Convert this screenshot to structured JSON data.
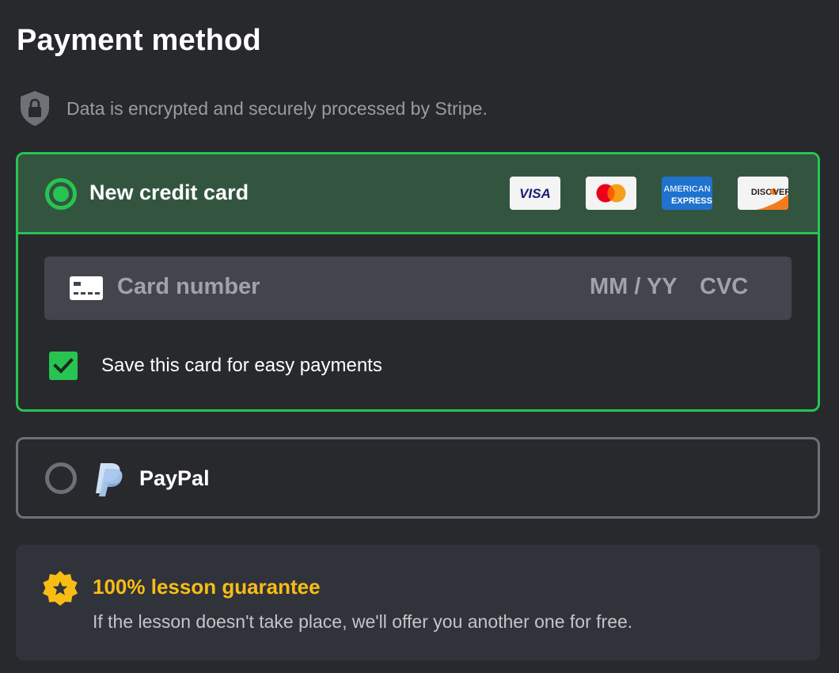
{
  "page": {
    "title": "Payment method"
  },
  "security": {
    "icon": "shield-lock-icon",
    "text": "Data is encrypted and securely processed by Stripe."
  },
  "credit_card": {
    "label": "New credit card",
    "selected": true,
    "brands": [
      "VISA",
      "Mastercard",
      "AMERICAN EXPRESS",
      "DISCOVER"
    ],
    "input": {
      "card_placeholder": "Card number",
      "expiry_placeholder": "MM / YY",
      "cvc_placeholder": "CVC"
    },
    "save_card": {
      "label": "Save this card for easy payments",
      "checked": true
    }
  },
  "paypal": {
    "label": "PayPal",
    "selected": false
  },
  "guarantee": {
    "title": "100% lesson guarantee",
    "text": "If the lesson doesn't take place, we'll offer you another one for free."
  },
  "colors": {
    "background": "#27292d",
    "accent_green": "#27c452",
    "selected_header": "#335540",
    "gold": "#f8bd14",
    "muted_text": "#9a9ca1"
  }
}
